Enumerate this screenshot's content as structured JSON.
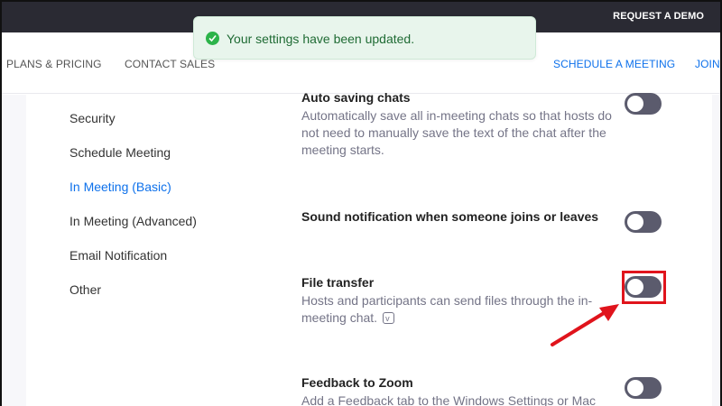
{
  "topbar": {
    "request_demo": "REQUEST A DEMO"
  },
  "nav": {
    "plans": "PLANS & PRICING",
    "contact": "CONTACT SALES",
    "schedule": "SCHEDULE A MEETING",
    "join": "JOIN"
  },
  "toast": {
    "message": "Your settings have been updated.",
    "icon": "check-circle-icon"
  },
  "sidebar": {
    "items": [
      {
        "label": "Security",
        "active": false
      },
      {
        "label": "Schedule Meeting",
        "active": false
      },
      {
        "label": "In Meeting (Basic)",
        "active": true
      },
      {
        "label": "In Meeting (Advanced)",
        "active": false
      },
      {
        "label": "Email Notification",
        "active": false
      },
      {
        "label": "Other",
        "active": false
      }
    ]
  },
  "settings": [
    {
      "title": "Auto saving chats",
      "description": "Automatically save all in-meeting chats so that hosts do not need to manually save the text of the chat after the meeting starts.",
      "enabled": false
    },
    {
      "title": "Sound notification when someone joins or leaves",
      "description": "",
      "enabled": false
    },
    {
      "title": "File transfer",
      "description": "Hosts and participants can send files through the in-meeting chat.",
      "enabled": false
    },
    {
      "title": "Feedback to Zoom",
      "description": "Add a Feedback tab to the Windows Settings or Mac",
      "enabled": false
    }
  ],
  "colors": {
    "accent": "#0e71eb",
    "toggle_off": "#5b5b6d",
    "toast_bg": "#e8f5ec",
    "highlight": "#e0141c"
  }
}
